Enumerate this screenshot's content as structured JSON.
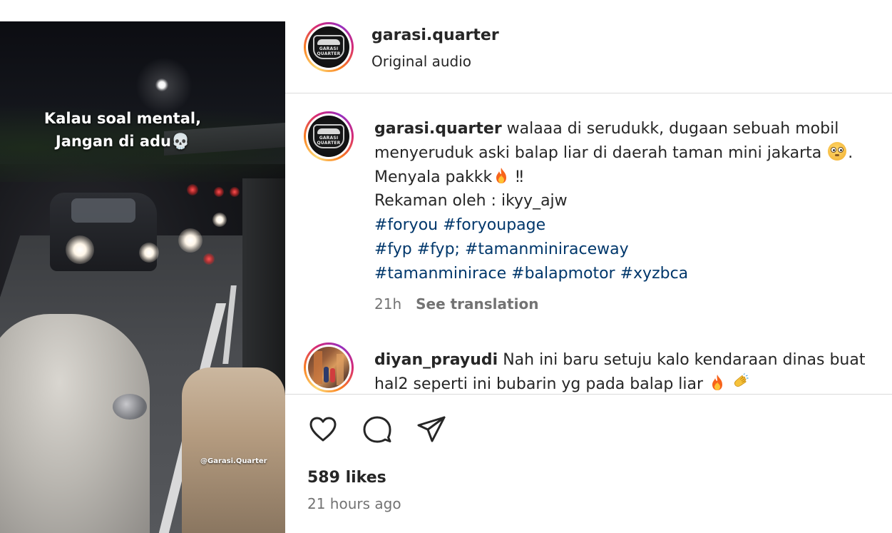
{
  "media": {
    "overlay_line1": "Kalau soal mental,",
    "overlay_line2": "Jangan di adu💀",
    "watermark": "@Garasi.Quarter"
  },
  "header": {
    "username": "garasi.quarter",
    "audio": "Original audio",
    "avatar_logo_text": "GARASI QUARTER"
  },
  "caption": {
    "username": "garasi.quarter",
    "text_line1": " walaaa di serudukk, dugaan sebuah mobil menyeruduk aski balap liar di daerah taman mini jakarta ",
    "text_after_flushed": ".",
    "text_line2": "Menyala pakkk",
    "text_after_fire": " ‼",
    "text_line3": "Rekaman oleh : ikyy_ajw",
    "hashtags_line1": "#foryou #foryoupage",
    "hashtags_line2": "#fyp #fyp; #tamanminiraceway",
    "hashtags_line3": "#tamanminirace #balapmotor #xyzbca",
    "time": "21h",
    "translate": "See translation"
  },
  "comment": {
    "username": "diyan_prayudi",
    "text": " Nah ini baru setuju kalo kendaraan dinas buat hal2 seperti ini bubarin yg pada balap liar "
  },
  "actions": {
    "like_icon": "heart-icon",
    "comment_icon": "comment-bubble-icon",
    "share_icon": "paper-plane-icon"
  },
  "likes": "589 likes",
  "time_ago": "21 hours ago",
  "colors": {
    "hashtag": "#00376b",
    "muted": "#737373",
    "text": "#262626",
    "divider": "#dbdbdb"
  }
}
